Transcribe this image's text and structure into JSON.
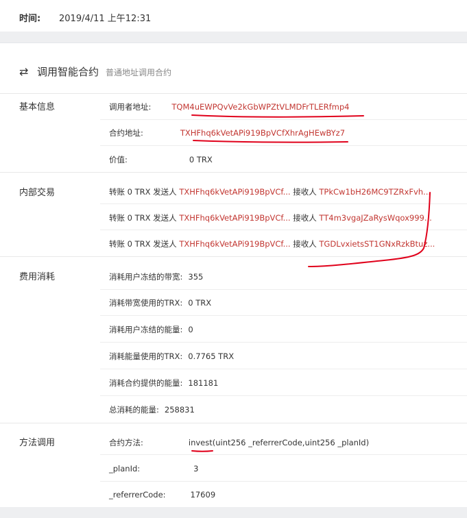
{
  "header": {
    "time_label": "时间:",
    "time_value": "2019/4/11 上午12:31"
  },
  "section": {
    "icon": "swap-arrows-icon",
    "title": "调用智能合约",
    "subtitle": "普通地址调用合约"
  },
  "basic_info": {
    "label": "基本信息",
    "caller_key": "调用者地址:",
    "caller_value": "TQM4uEWPQvVe2kGbWPZtVLMDFrTLERfmp4",
    "contract_key": "合约地址:",
    "contract_value": "TXHFhq6kVetAPi919BpVCfXhrAgHEwBYz7",
    "value_key": "价值:",
    "value_value": "0 TRX"
  },
  "internal_tx": {
    "label": "内部交易",
    "rows": [
      {
        "prefix": "转账 0 TRX 发送人",
        "sender": "TXHFhq6kVetAPi919BpVCf...",
        "recv_label": "接收人",
        "receiver": "TPkCw1bH26MC9TZRxFvh..."
      },
      {
        "prefix": "转账 0 TRX 发送人",
        "sender": "TXHFhq6kVetAPi919BpVCf...",
        "recv_label": "接收人",
        "receiver": "TT4m3vgaJZaRysWqox999..."
      },
      {
        "prefix": "转账 0 TRX 发送人",
        "sender": "TXHFhq6kVetAPi919BpVCf...",
        "recv_label": "接收人",
        "receiver": "TGDLvxietsST1GNxRzkBtuz..."
      }
    ]
  },
  "fees": {
    "label": "费用消耗",
    "rows": [
      {
        "key": "消耗用户冻结的带宽:",
        "value": "355"
      },
      {
        "key": "消耗带宽使用的TRX:",
        "value": "0 TRX"
      },
      {
        "key": "消耗用户冻结的能量:",
        "value": "0"
      },
      {
        "key": "消耗能量使用的TRX:",
        "value": "0.7765 TRX"
      },
      {
        "key": "消耗合约提供的能量:",
        "value": "181181"
      },
      {
        "key": "总消耗的能量:",
        "value": "258831"
      }
    ]
  },
  "method": {
    "label": "方法调用",
    "rows": [
      {
        "key": "合约方法:",
        "value": "invest(uint256 _referrerCode,uint256 _planId)"
      },
      {
        "key": "_planId:",
        "value": "3"
      },
      {
        "key": "_referrerCode:",
        "value": "17609"
      }
    ]
  },
  "colors": {
    "link_red": "#c23631",
    "annotation_red": "#e0001a",
    "page_gray": "#eeeff1"
  }
}
